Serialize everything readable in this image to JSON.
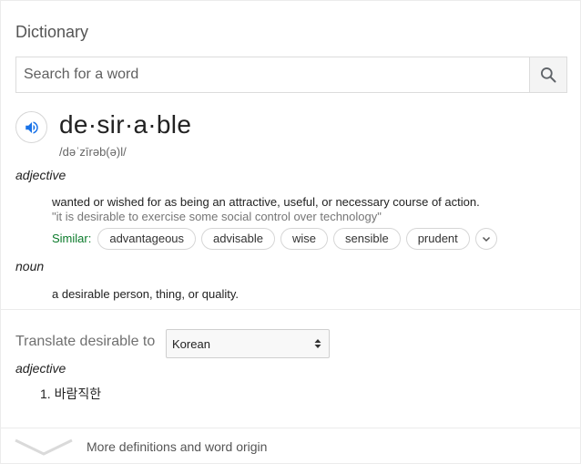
{
  "dictionary": {
    "title": "Dictionary",
    "search": {
      "placeholder": "Search for a word",
      "value": ""
    },
    "entry": {
      "headword": "de·sir·a·ble",
      "phonetic": "/dəˈzīrəb(ə)l/",
      "senses": [
        {
          "pos": "adjective",
          "definition": "wanted or wished for as being an attractive, useful, or necessary course of action.",
          "example": "\"it is desirable to exercise some social control over technology\"",
          "similar_label": "Similar:",
          "similar": [
            "advantageous",
            "advisable",
            "wise",
            "sensible",
            "prudent"
          ]
        },
        {
          "pos": "noun",
          "definition": "a desirable person, thing, or quality."
        }
      ]
    },
    "translate": {
      "label": "Translate desirable to",
      "language": "Korean",
      "pos": "adjective",
      "items": [
        "1. 바람직한"
      ]
    },
    "more_link": "More definitions and word origin"
  },
  "colors": {
    "similar_label": "#0a7a2a",
    "speaker_icon": "#1a73e8",
    "search_icon": "#5f6368"
  }
}
